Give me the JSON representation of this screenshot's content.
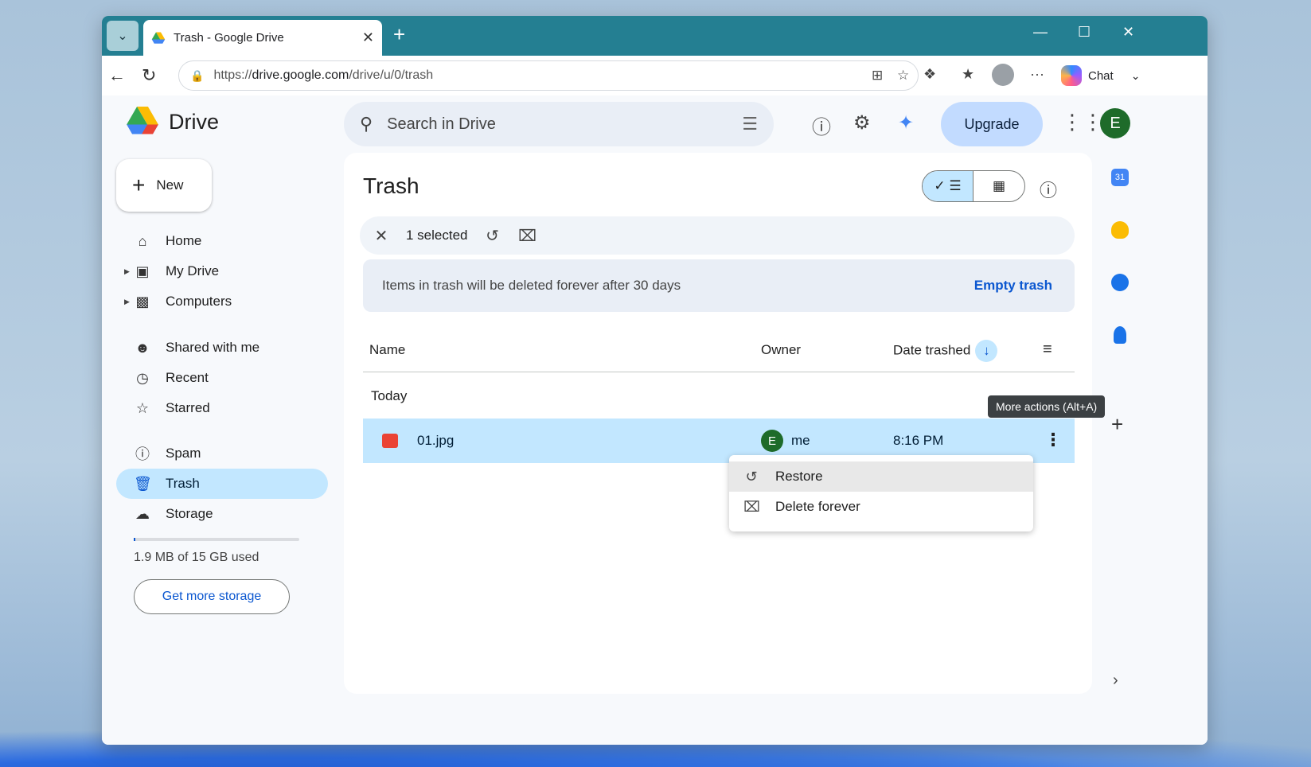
{
  "browser": {
    "tab_title": "Trash - Google Drive",
    "url_prefix": "https://",
    "url_host": "drive.google.com",
    "url_path": "/drive/u/0/trash",
    "chat_label": "Chat"
  },
  "header": {
    "app_name": "Drive",
    "search_placeholder": "Search in Drive",
    "upgrade_label": "Upgrade",
    "avatar_letter": "E"
  },
  "sidebar": {
    "new_label": "New",
    "items": [
      {
        "label": "Home",
        "icon": "home-icon"
      },
      {
        "label": "My Drive",
        "icon": "my-drive-icon"
      },
      {
        "label": "Computers",
        "icon": "computers-icon"
      },
      {
        "label": "Shared with me",
        "icon": "shared-icon"
      },
      {
        "label": "Recent",
        "icon": "clock-icon"
      },
      {
        "label": "Starred",
        "icon": "star-icon"
      },
      {
        "label": "Spam",
        "icon": "spam-icon"
      },
      {
        "label": "Trash",
        "icon": "trash-icon"
      },
      {
        "label": "Storage",
        "icon": "cloud-icon"
      }
    ],
    "storage_text": "1.9 MB of 15 GB used",
    "storage_used_fraction": 0.01,
    "more_storage_label": "Get more storage"
  },
  "main": {
    "title": "Trash",
    "selected_text": "1 selected",
    "banner_text": "Items in trash will be deleted forever after 30 days",
    "empty_trash_label": "Empty trash",
    "columns": {
      "name": "Name",
      "owner": "Owner",
      "date": "Date trashed"
    },
    "group_label": "Today",
    "files": [
      {
        "name": "01.jpg",
        "owner_letter": "E",
        "owner": "me",
        "date": "8:16 PM"
      }
    ],
    "tooltip": "More actions (Alt+A)",
    "context_menu": [
      "Restore",
      "Delete forever"
    ]
  },
  "side_panel": {
    "calendar_day": "31"
  },
  "colors": {
    "tabbar": "#247f92",
    "selection": "#c2e7ff",
    "accent": "#0b57d0"
  }
}
